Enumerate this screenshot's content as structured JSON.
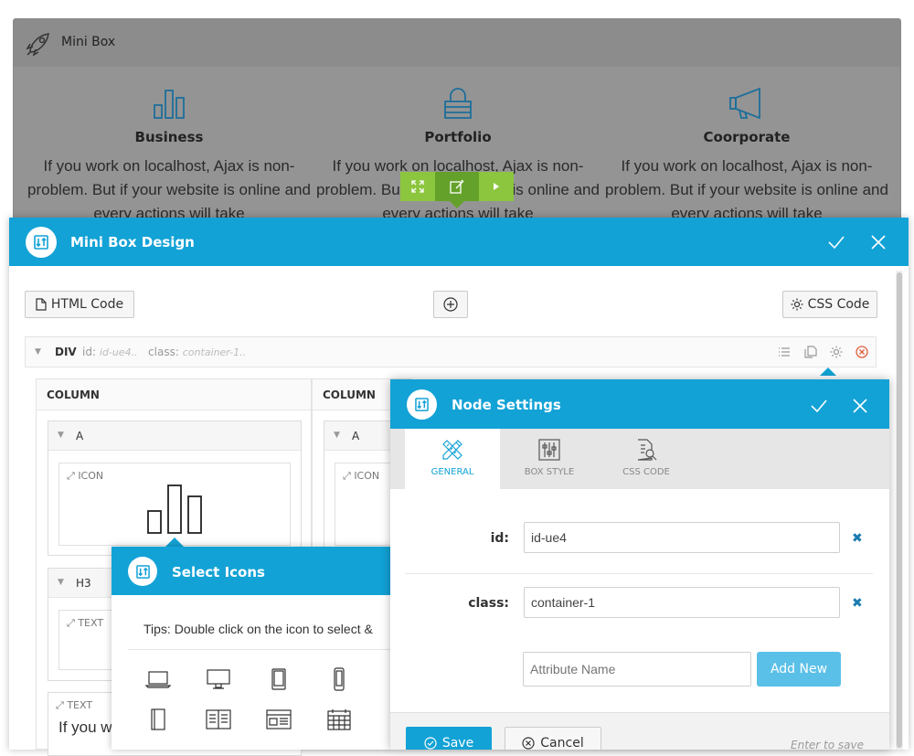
{
  "colors": {
    "accent": "#12a2d6",
    "green": "#8cc63f",
    "green_dark": "#64a12a",
    "overlay_gray": "#949494"
  },
  "minibox": {
    "title": "Mini Box",
    "icon": "rocket-icon",
    "columns": [
      {
        "icon": "bar-chart-icon",
        "heading": "Business",
        "text": "If you work on localhost, Ajax is non-problem. But if your website is online and every actions will take"
      },
      {
        "icon": "lock-icon",
        "heading": "Portfolio",
        "text": "If you work on localhost, Ajax is non-problem. But if your website is online and every actions will take"
      },
      {
        "icon": "megaphone-icon",
        "heading": "Coorporate",
        "text": "If you work on localhost, Ajax is non-problem. But if your website is online and every actions will take"
      }
    ],
    "toolbar": [
      "expand-icon",
      "edit-icon",
      "play-icon"
    ]
  },
  "dialog": {
    "title": "Mini Box Design",
    "html_code_label": "HTML Code",
    "css_code_label": "CSS Code",
    "node": {
      "tag": "DIV",
      "id_key": "id:",
      "id_value": "id-ue4..",
      "class_key": "class:",
      "class_value": "container-1.."
    },
    "columns": [
      {
        "label": "COLUMN",
        "element": "A",
        "icon_label": "ICON",
        "h3": "H3",
        "text_label": "TEXT",
        "text2_label": "TEXT",
        "text_snippet": "If you w"
      },
      {
        "label": "COLUMN",
        "element": "A",
        "icon_label": "ICON"
      }
    ]
  },
  "select_icons": {
    "title": "Select Icons",
    "tips": "Tips: Double click on the icon to select &"
  },
  "node_settings": {
    "title": "Node Settings",
    "tabs": [
      {
        "label": "GENERAL",
        "icon": "pencil-ruler-icon",
        "active": true
      },
      {
        "label": "BOX STYLE",
        "icon": "sliders-icon",
        "active": false
      },
      {
        "label": "CSS CODE",
        "icon": "file-search-icon",
        "active": false
      }
    ],
    "id_label": "id:",
    "id_value": "id-ue4",
    "class_label": "class:",
    "class_value": "container-1",
    "attribute_placeholder": "Attribute Name",
    "add_new_label": "Add New",
    "save_label": "Save",
    "cancel_label": "Cancel",
    "enter_hint": "Enter to save"
  }
}
